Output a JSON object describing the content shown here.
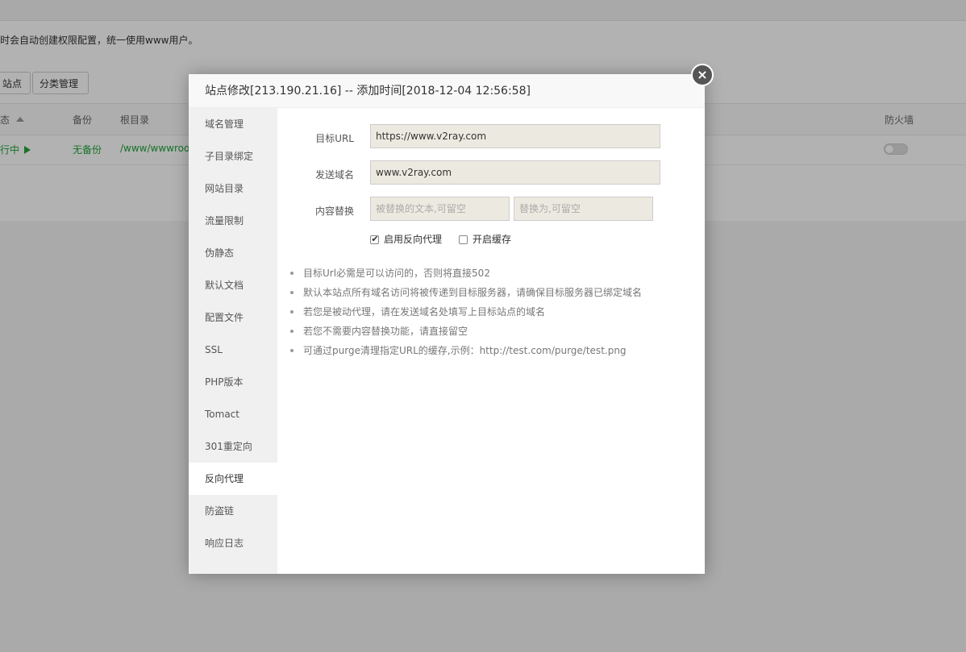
{
  "background": {
    "notice": "时会自动创建权限配置，统一使用www用户。",
    "buttons": [
      "站点",
      "分类管理"
    ],
    "table_headers": {
      "status": "状态",
      "backup": "备份",
      "root": "根目录",
      "firewall": "防火墙"
    },
    "row": {
      "status": "运行中",
      "backup": "无备份",
      "root": "/www/wwwroot"
    }
  },
  "modal": {
    "title": "站点修改[213.190.21.16] -- 添加时间[2018-12-04 12:56:58]",
    "close_icon": "close-icon",
    "sidebar": [
      {
        "label": "域名管理"
      },
      {
        "label": "子目录绑定"
      },
      {
        "label": "网站目录"
      },
      {
        "label": "流量限制"
      },
      {
        "label": "伪静态"
      },
      {
        "label": "默认文档"
      },
      {
        "label": "配置文件"
      },
      {
        "label": "SSL"
      },
      {
        "label": "PHP版本"
      },
      {
        "label": "Tomact"
      },
      {
        "label": "301重定向"
      },
      {
        "label": "反向代理"
      },
      {
        "label": "防盗链"
      },
      {
        "label": "响应日志"
      }
    ],
    "active_tab": "反向代理",
    "form": {
      "target_url_label": "目标URL",
      "target_url_value": "https://www.v2ray.com",
      "send_domain_label": "发送域名",
      "send_domain_value": "www.v2ray.com",
      "replace_label": "内容替换",
      "replace_from_placeholder": "被替换的文本,可留空",
      "replace_to_placeholder": "替换为,可留空",
      "enable_proxy_label": "启用反向代理",
      "enable_proxy_checked": true,
      "enable_cache_label": "开启缓存",
      "enable_cache_checked": false
    },
    "help": [
      "目标Url必需是可以访问的，否则将直接502",
      "默认本站点所有域名访问将被传递到目标服务器，请确保目标服务器已绑定域名",
      "若您是被动代理，请在发送域名处填写上目标站点的域名",
      "若您不需要内容替换功能，请直接留空",
      "可通过purge清理指定URL的缓存,示例：http://test.com/purge/test.png"
    ]
  },
  "colors": {
    "accent_green": "#20a53a",
    "overlay": "rgba(0,0,0,0.3)"
  }
}
